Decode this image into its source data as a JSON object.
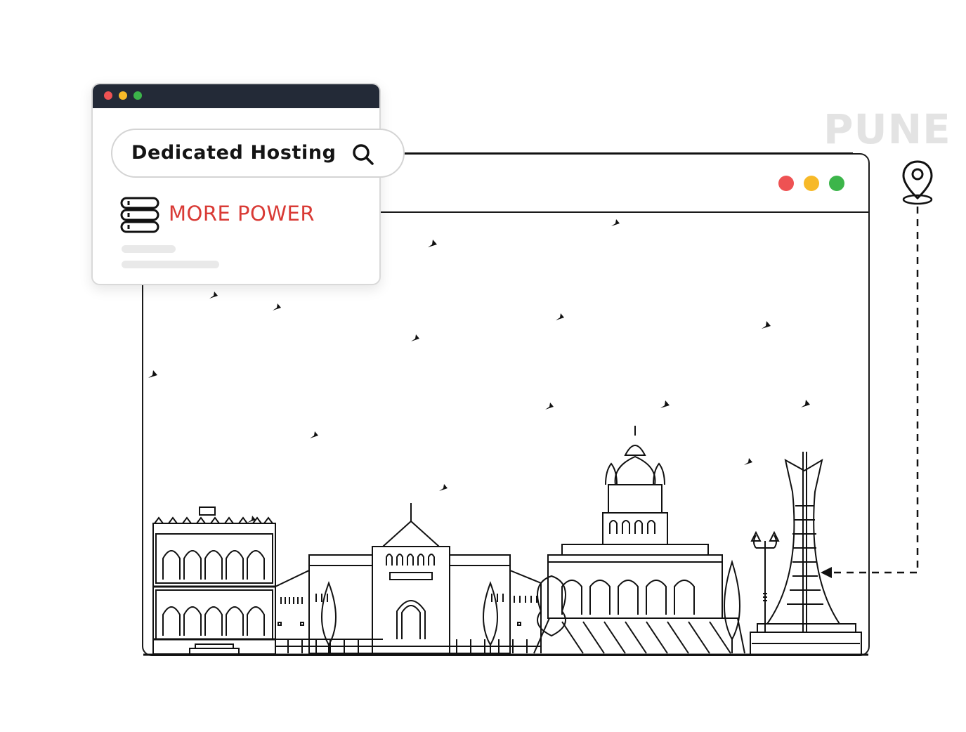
{
  "card": {
    "search_text": "Dedicated Hosting",
    "feature_text": "MORE POWER",
    "dots": [
      "#ee5253",
      "#f7b928",
      "#3cb54a"
    ]
  },
  "window": {
    "dots": [
      "#ee5253",
      "#f7b928",
      "#3cb54a"
    ]
  },
  "location": {
    "city": "PUNE",
    "icon": "map-pin-icon"
  },
  "icons": [
    "search-icon",
    "server-icon",
    "map-pin-icon",
    "bird-icon"
  ],
  "colors": {
    "accent": "#d93a35",
    "header": "#232a37",
    "label": "#e3e3e3"
  }
}
